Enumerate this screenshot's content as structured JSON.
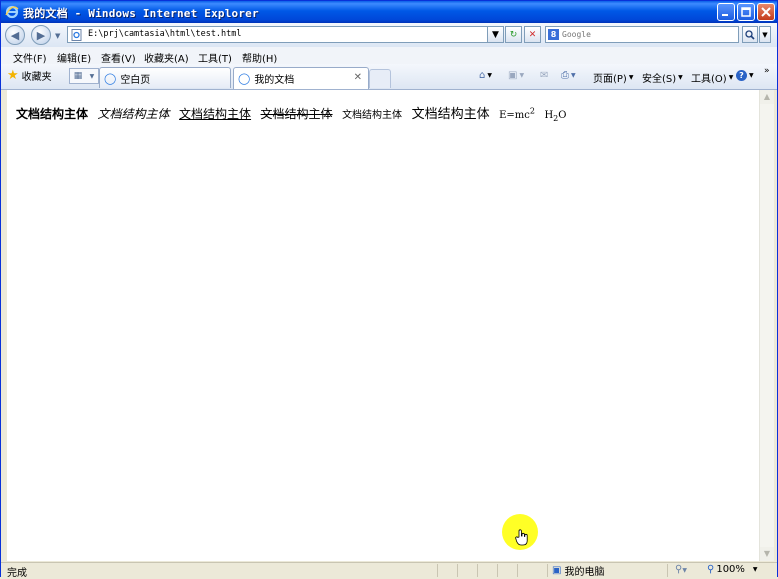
{
  "window": {
    "title": "我的文档 - Windows Internet Explorer"
  },
  "address_bar": {
    "url": "E:\\prj\\camtasia\\html\\test.html",
    "search_placeholder": "Google"
  },
  "menu": {
    "items": [
      "文件(F)",
      "编辑(E)",
      "查看(V)",
      "收藏夹(A)",
      "工具(T)",
      "帮助(H)"
    ]
  },
  "tabs": {
    "favorites_label": "收藏夹",
    "items": [
      {
        "label": "空白页",
        "active": false
      },
      {
        "label": "我的文档",
        "active": true
      }
    ]
  },
  "command_bar": {
    "page_label": "页面(P)",
    "safety_label": "安全(S)",
    "tools_label": "工具(O)"
  },
  "document": {
    "bold": "文档结构主体",
    "italic": "文档结构主体",
    "underline": "文档结构主体",
    "strike": "文档结构主体",
    "small": "文档结构主体",
    "big": "文档结构主体",
    "formula_sup_base": "E=mc",
    "formula_sup": "2",
    "formula_sub_base": "H",
    "formula_sub": "2",
    "formula_sub_tail": "O"
  },
  "status": {
    "left": "完成",
    "zone": "我的电脑",
    "zoom": "100%"
  },
  "colors": {
    "titlebar": "#0058e6",
    "highlight_cursor": "#ffff00"
  }
}
